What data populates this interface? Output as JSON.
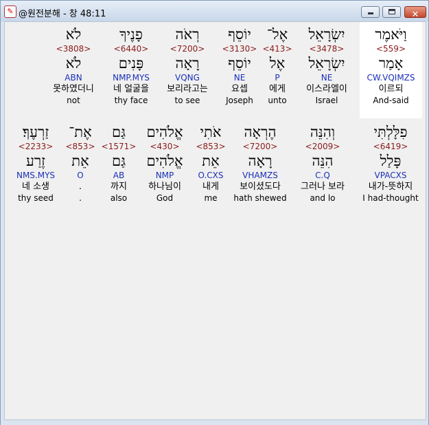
{
  "window": {
    "title": "@원전분해 - 창 48:11",
    "app_icon": "bible-book-icon",
    "controls": {
      "minimize_icon": "minimize-icon",
      "maximize_icon": "maximize-icon",
      "close_glyph": "✕"
    }
  },
  "verse": {
    "line1": [
      {
        "heb": "וַיֹּאמֶר",
        "strong": "<559>",
        "lemma": "אָמַר",
        "parse": "CW.VQIMZS",
        "kor": "이르되",
        "eng": "And-said"
      },
      {
        "heb": "יִשְׂרָאֵל",
        "strong": "<3478>",
        "lemma": "יִשְׂרָאֵל",
        "parse": "NE",
        "kor": "이스라엘이",
        "eng": "Israel"
      },
      {
        "heb": "אֶל־",
        "strong": "<413>",
        "lemma": "אֶל",
        "parse": "P",
        "kor": "에게",
        "eng": "unto"
      },
      {
        "heb": "יוֹסֵף",
        "strong": "<3130>",
        "lemma": "יוֹסֵף",
        "parse": "NE",
        "kor": "요셉",
        "eng": "Joseph"
      },
      {
        "heb": "רְאֹה",
        "strong": "<7200>",
        "lemma": "רָאָה",
        "parse": "VQNG",
        "kor": "보리라고는",
        "eng": "to see"
      },
      {
        "heb": "פָנֶיךָ",
        "strong": "<6440>",
        "lemma": "פָּנִים",
        "parse": "NMP.MYS",
        "kor": "네 얼굴을",
        "eng": "thy face"
      },
      {
        "heb": "לֹא",
        "strong": "<3808>",
        "lemma": "לֹא",
        "parse": "ABN",
        "kor": "못하였더니",
        "eng": "not"
      }
    ],
    "line2": [
      {
        "heb": "פִלָּלְתִּי",
        "strong": "<6419>",
        "lemma": "פָּלַל",
        "parse": "VPACXS",
        "kor": "내가-뜻하지",
        "eng": "I had-thought"
      },
      {
        "heb": "וְהִנֵּה",
        "strong": "<2009>",
        "lemma": "הִנֵּה",
        "parse": "C.Q",
        "kor": "그러나 보라",
        "eng": "and lo"
      },
      {
        "heb": "הֶרְאָה",
        "strong": "<7200>",
        "lemma": "רָאָה",
        "parse": "VHAMZS",
        "kor": "보이셨도다",
        "eng": "hath shewed"
      },
      {
        "heb": "אֹתִי",
        "strong": "<853>",
        "lemma": "אֵת",
        "parse": "O.CXS",
        "kor": "내게",
        "eng": "me"
      },
      {
        "heb": "אֱלֹהִים",
        "strong": "<430>",
        "lemma": "אֱלֹהִים",
        "parse": "NMP",
        "kor": "하나님이",
        "eng": "God"
      },
      {
        "heb": "גַּם",
        "strong": "<1571>",
        "lemma": "גַּם",
        "parse": "AB",
        "kor": "까지",
        "eng": "also"
      },
      {
        "heb": "אֶת־",
        "strong": "<853>",
        "lemma": "אֵת",
        "parse": "O",
        "kor": ".",
        "eng": "."
      },
      {
        "heb": "זַרְעֶךָ׃",
        "strong": "<2233>",
        "lemma": "זֶרַע",
        "parse": "NMS.MYS",
        "kor": "네 소생",
        "eng": "thy seed"
      }
    ]
  }
}
